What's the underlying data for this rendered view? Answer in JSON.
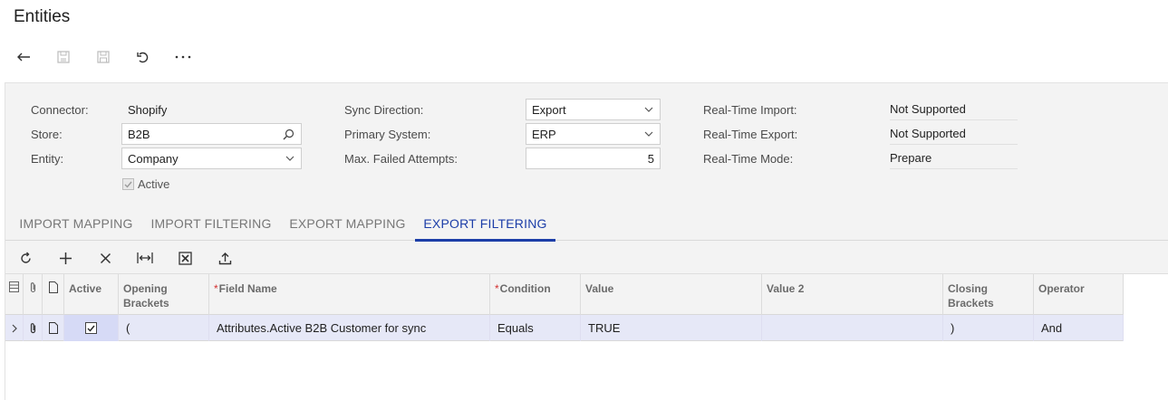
{
  "page": {
    "title": "Entities"
  },
  "toolbar": {
    "buttons": [
      {
        "name": "back-icon",
        "enabled": true
      },
      {
        "name": "save-close-icon",
        "enabled": false
      },
      {
        "name": "save-icon",
        "enabled": false
      },
      {
        "name": "undo-icon",
        "enabled": true
      },
      {
        "name": "more-icon",
        "enabled": true
      }
    ]
  },
  "form": {
    "connector": {
      "label": "Connector:",
      "value": "Shopify"
    },
    "store": {
      "label": "Store:",
      "value": "B2B"
    },
    "entity": {
      "label": "Entity:",
      "value": "Company"
    },
    "active": {
      "label": "Active",
      "checked": true
    },
    "sync_direction": {
      "label": "Sync Direction:",
      "value": "Export"
    },
    "primary_system": {
      "label": "Primary System:",
      "value": "ERP"
    },
    "max_failed_attempts": {
      "label": "Max. Failed Attempts:",
      "value": "5"
    },
    "realtime_import": {
      "label": "Real-Time Import:",
      "value": "Not Supported"
    },
    "realtime_export": {
      "label": "Real-Time Export:",
      "value": "Not Supported"
    },
    "realtime_mode": {
      "label": "Real-Time Mode:",
      "value": "Prepare"
    }
  },
  "tabs": [
    {
      "label": "IMPORT MAPPING",
      "active": false
    },
    {
      "label": "IMPORT FILTERING",
      "active": false
    },
    {
      "label": "EXPORT MAPPING",
      "active": false
    },
    {
      "label": "EXPORT FILTERING",
      "active": true
    }
  ],
  "grid_toolbar": {
    "buttons": [
      "refresh-icon",
      "add-row-icon",
      "delete-row-icon",
      "fit-columns-icon",
      "export-excel-icon",
      "upload-icon"
    ]
  },
  "grid": {
    "columns": [
      {
        "key": "active",
        "label": "Active",
        "required": false
      },
      {
        "key": "opening",
        "label": "Opening Brackets",
        "required": false
      },
      {
        "key": "field",
        "label": "Field Name",
        "required": true
      },
      {
        "key": "condition",
        "label": "Condition",
        "required": true
      },
      {
        "key": "value",
        "label": "Value",
        "required": false
      },
      {
        "key": "value2",
        "label": "Value 2",
        "required": false
      },
      {
        "key": "closing",
        "label": "Closing Brackets",
        "required": false
      },
      {
        "key": "operator",
        "label": "Operator",
        "required": false
      }
    ],
    "rows": [
      {
        "active": true,
        "opening": "(",
        "field": "Attributes.Active B2B Customer for sync",
        "condition": "Equals",
        "value": "TRUE",
        "value2": "",
        "closing": ")",
        "operator": "And"
      }
    ]
  },
  "colors": {
    "accent": "#1c3ea8",
    "selected_row": "#e6e8f7",
    "required": "#d32f2f"
  }
}
